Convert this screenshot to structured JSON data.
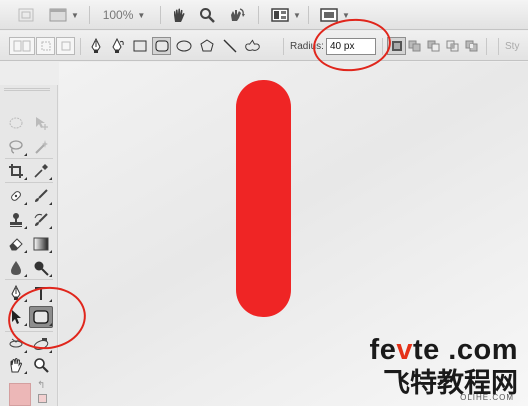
{
  "app_bar": {
    "zoom": "100%",
    "icons": [
      "home-icon",
      "frame-icon",
      "hand-tool-icon",
      "zoom-tool-icon",
      "rotate-view-icon",
      "arrange-documents-icon",
      "screen-mode-icon"
    ]
  },
  "options_bar": {
    "tool_preset_icon": "tool-preset-icon",
    "mode_icons": [
      "shape-layers-icon",
      "paths-icon",
      "fill-pixels-icon"
    ],
    "shape_icons": [
      "pen-icon",
      "freeform-pen-icon",
      "rectangle-icon",
      "rounded-rectangle-icon",
      "ellipse-icon",
      "polygon-icon",
      "line-icon",
      "custom-shape-icon"
    ],
    "radius_label": "Radius:",
    "radius_value": "40 px",
    "combine_icons": [
      "create-new-layer-icon",
      "add-to-area-icon",
      "subtract-icon",
      "intersect-icon",
      "exclude-icon"
    ],
    "right_label": "Sty"
  },
  "tools": [
    "rectangular-marquee-icon",
    "move-icon",
    "lasso-icon",
    "magic-wand-icon",
    "crop-icon",
    "eyedropper-icon",
    "spot-healing-icon",
    "brush-icon",
    "clone-stamp-icon",
    "history-brush-icon",
    "eraser-icon",
    "gradient-icon",
    "blur-icon",
    "dodge-icon",
    "pen-tool-icon",
    "type-icon",
    "path-selection-icon",
    "rounded-rectangle-tool-icon",
    "3d-rotate-icon",
    "3d-orbit-icon",
    "hand-icon",
    "zoom-icon"
  ],
  "colors": {
    "shape_fill": "#ef2525",
    "highlight_ring": "#e0261c",
    "foreground_swatch": "#ecb7b7"
  },
  "watermark": {
    "brand_prefix": "fe",
    "brand_v": "v",
    "brand_suffix": "te .com",
    "chinese": "飞特教程网",
    "small": "OLIHE.COM"
  }
}
